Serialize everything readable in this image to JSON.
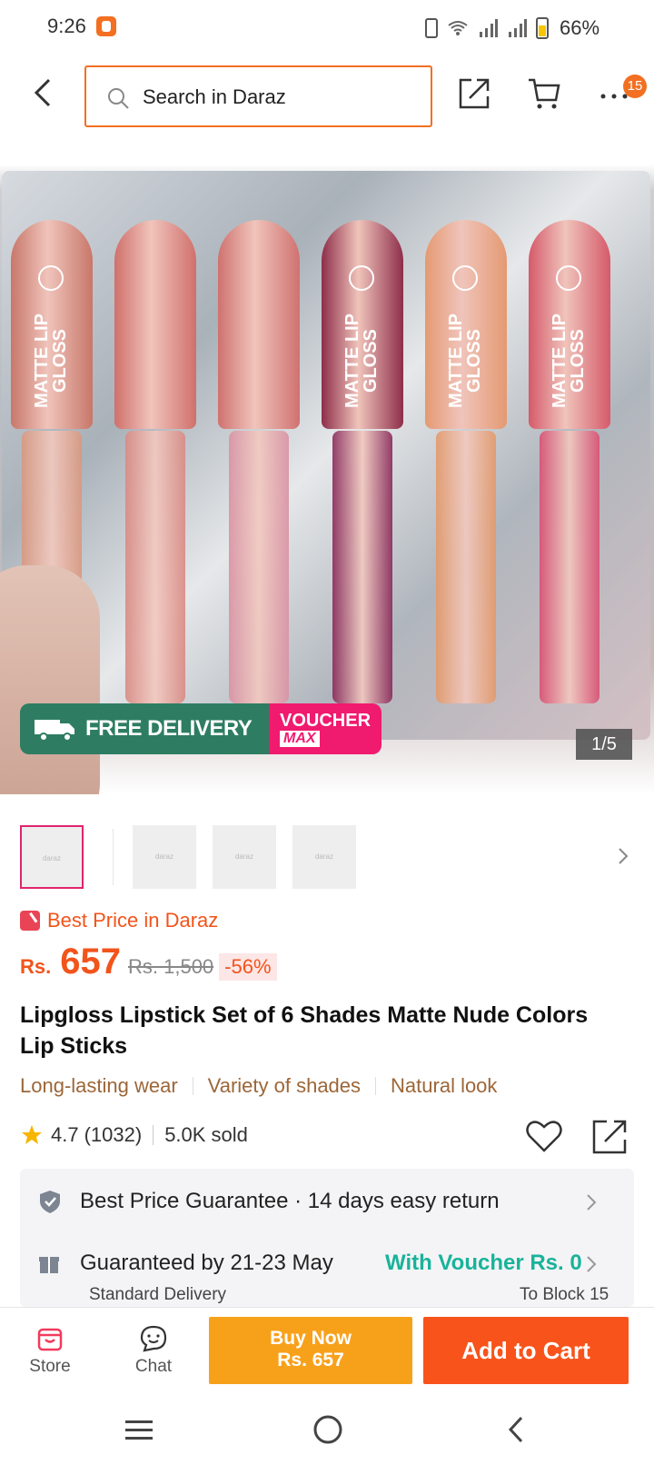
{
  "status_bar": {
    "time": "9:26",
    "battery": "66%"
  },
  "search": {
    "placeholder": "Search in Daraz"
  },
  "header": {
    "more_badge": "15"
  },
  "product_image": {
    "badge_free": "FREE DELIVERY",
    "badge_voucher_top": "VOUCHER",
    "badge_voucher_bottom": "MAX",
    "counter": "1/5"
  },
  "thumbnails": [
    {
      "label": "daraz"
    },
    {
      "label": "daraz"
    },
    {
      "label": "daraz"
    },
    {
      "label": "daraz"
    }
  ],
  "price": {
    "best_price_label": "Best Price in Daraz",
    "currency": "Rs.",
    "value": "657",
    "original": "Rs. 1,500",
    "discount": "-56%"
  },
  "product": {
    "title": "Lipgloss Lipstick Set of 6 Shades Matte Nude Colors Lip Sticks",
    "tags": [
      "Long-lasting wear",
      "Variety of shades",
      "Natural look"
    ],
    "rating": "4.7",
    "reviews": "(1032)",
    "sold": "5.0K sold"
  },
  "info": {
    "guarantee": "Best Price Guarantee · 14 days easy return",
    "delivery": "Guaranteed by 21-23 May",
    "voucher": "With Voucher Rs. 0",
    "delivery_type": "Standard Delivery",
    "location": "To Block 15"
  },
  "actions": {
    "store": "Store",
    "chat": "Chat",
    "buy_now_line1": "Buy Now",
    "buy_now_line2": "Rs. 657",
    "add_to_cart": "Add to Cart"
  },
  "lipsticks": [
    {
      "cap_color": "#c8776a",
      "tube_color": "#d99880",
      "label": "MATTE LIP GLOSS"
    },
    {
      "cap_color": "#d0706c",
      "tube_color": "#d98a84",
      "label": ""
    },
    {
      "cap_color": "#cf7270",
      "tube_color": "#d992a3",
      "label": ""
    },
    {
      "cap_color": "#8e2e4a",
      "tube_color": "#8a2a5a",
      "label": "MATTE LIP GLOSS"
    },
    {
      "cap_color": "#e49a72",
      "tube_color": "#e3996a",
      "label": "MATTE LIP GLOSS"
    },
    {
      "cap_color": "#d55a6a",
      "tube_color": "#d94f72",
      "label": "MATTE LIP GLOSS"
    }
  ],
  "colors": {
    "accent": "#f36f21",
    "price": "#f2541b",
    "buy_now": "#f7a11b",
    "add_to_cart": "#f8531b",
    "voucher_green": "#19b39a",
    "free_delivery_green": "#2e7d62",
    "voucher_pink": "#f01a6f"
  }
}
